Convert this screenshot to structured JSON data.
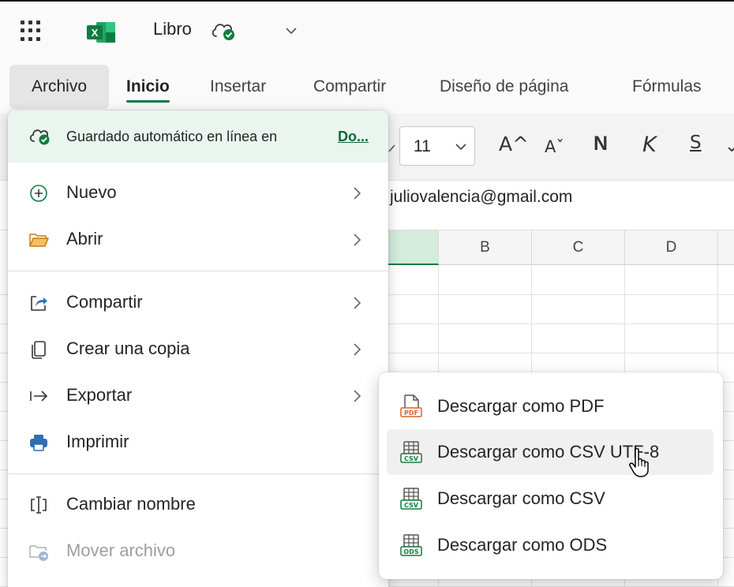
{
  "titlebar": {
    "app_icon": "excel-logo",
    "doc_title": "Libro"
  },
  "ribbon_tabs": [
    {
      "label": "Archivo",
      "active_menu": true
    },
    {
      "label": "Inicio",
      "selected": true
    },
    {
      "label": "Insertar"
    },
    {
      "label": "Compartir"
    },
    {
      "label": "Diseño de página"
    },
    {
      "label": "Fórmulas"
    }
  ],
  "toolbar": {
    "font_size": "11",
    "grow_font": "A^",
    "shrink_font": "Aˇ",
    "bold": "N",
    "italic": "K",
    "underline": "S"
  },
  "formula_bar": {
    "content": "juliovalencia@gmail.com"
  },
  "grid": {
    "columns": [
      "B",
      "C",
      "D"
    ]
  },
  "file_menu": {
    "autosave_text": "Guardado automático en línea en",
    "autosave_link": "Do...",
    "items": [
      {
        "label": "Nuevo",
        "icon": "plus-circle-icon",
        "submenu": true
      },
      {
        "label": "Abrir",
        "icon": "folder-open-icon",
        "submenu": true
      },
      {
        "label": "Compartir",
        "icon": "share-icon",
        "submenu": true
      },
      {
        "label": "Crear una copia",
        "icon": "copy-icon",
        "submenu": true
      },
      {
        "label": "Exportar",
        "icon": "export-arrow-icon",
        "submenu": true
      },
      {
        "label": "Imprimir",
        "icon": "printer-icon",
        "submenu": false
      },
      {
        "label": "Cambiar nombre",
        "icon": "rename-icon",
        "submenu": false
      },
      {
        "label": "Mover archivo",
        "icon": "move-folder-icon",
        "submenu": false,
        "disabled": true
      }
    ]
  },
  "export_submenu": {
    "items": [
      {
        "label": "Descargar como PDF",
        "icon": "pdf-file-icon"
      },
      {
        "label": "Descargar como CSV UTF-8",
        "icon": "csv-file-icon",
        "hovered": true
      },
      {
        "label": "Descargar como CSV",
        "icon": "csv-file-icon"
      },
      {
        "label": "Descargar como ODS",
        "icon": "ods-file-icon"
      }
    ]
  },
  "colors": {
    "excel_green": "#107c41",
    "autosave_bg": "#e9f5ee",
    "pdf_orange": "#d9632a",
    "folder_orange": "#e8a33c",
    "share_blue": "#2f6fb5"
  }
}
